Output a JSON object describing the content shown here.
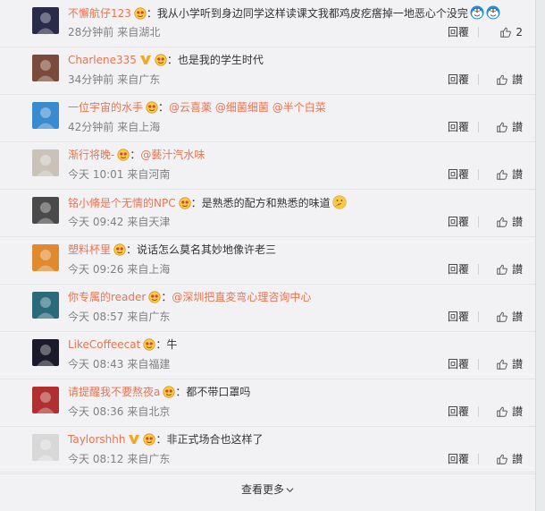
{
  "comments": [
    {
      "user": "不懈航仔123",
      "segments": [
        {
          "t": "：我从小学听到身边同学这样读课文我都鸡皮疙瘩掉一地恶心个没完",
          "m": false
        }
      ],
      "emojis": [
        "doraemon-emoji",
        "doraemon-emoji"
      ],
      "time": "28分钟前",
      "source": "来自湖北",
      "reply": "回覆",
      "likes": "2",
      "avatar_color": "#2a2a4a"
    },
    {
      "user": "Charlene335",
      "verified": true,
      "segments": [
        {
          "t": "：也是我的学生时代",
          "m": false
        }
      ],
      "time": "34分钟前",
      "source": "来自广东",
      "reply": "回覆",
      "likes": "讃",
      "avatar_color": "#7a4a3a"
    },
    {
      "user": "一位宇宙的水手",
      "segments": [
        {
          "t": "：",
          "m": false
        },
        {
          "t": "@云喜薬",
          "m": true
        },
        {
          "t": " ",
          "m": false
        },
        {
          "t": "@细菌细菌",
          "m": true
        },
        {
          "t": " ",
          "m": false
        },
        {
          "t": "@半个白菜",
          "m": true
        }
      ],
      "time": "42分钟前",
      "source": "来自上海",
      "reply": "回覆",
      "likes": "讃",
      "avatar_color": "#3a8ad0"
    },
    {
      "user": "渐行将晚-",
      "segments": [
        {
          "t": "：",
          "m": false
        },
        {
          "t": "@藝汁汽水味",
          "m": true
        }
      ],
      "time": "今天 10:01",
      "source": "来自河南",
      "reply": "回覆",
      "likes": "讃",
      "avatar_color": "#c8c2b8"
    },
    {
      "user": "铭小脩是个无情的NPC",
      "segments": [
        {
          "t": "：是熟悉的配方和熟悉的味道",
          "m": false
        }
      ],
      "emojis": [
        "thinking-emoji"
      ],
      "time": "今天 09:42",
      "source": "来自天津",
      "reply": "回覆",
      "likes": "讃",
      "avatar_color": "#4a4a4a"
    },
    {
      "user": "塑料杯里",
      "segments": [
        {
          "t": "：说话怎么莫名其妙地像许老三",
          "m": false
        }
      ],
      "time": "今天 09:26",
      "source": "来自上海",
      "reply": "回覆",
      "likes": "讃",
      "avatar_color": "#e08a30"
    },
    {
      "user": "你专属的reader",
      "segments": [
        {
          "t": "：",
          "m": false
        },
        {
          "t": "@深圳把直変弯心理咨询中心",
          "m": true
        }
      ],
      "time": "今天 08:57",
      "source": "来自广东",
      "reply": "回覆",
      "likes": "讃",
      "avatar_color": "#2a6a7a"
    },
    {
      "user": "LikeCoffeecat",
      "segments": [
        {
          "t": "：牛",
          "m": false
        }
      ],
      "time": "今天 08:43",
      "source": "来自福建",
      "reply": "回覆",
      "likes": "讃",
      "avatar_color": "#1a1a2a"
    },
    {
      "user": "请提醒我不要熬夜a",
      "segments": [
        {
          "t": "：都不带口罩吗",
          "m": false
        }
      ],
      "time": "今天 08:36",
      "source": "来自北京",
      "reply": "回覆",
      "likes": "讃",
      "avatar_color": "#b03030"
    },
    {
      "user": "Taylorshhh",
      "verified": true,
      "segments": [
        {
          "t": "：非正式场合也这样了",
          "m": false
        }
      ],
      "time": "今天 08:12",
      "source": "来自广东",
      "reply": "回覆",
      "likes": "讃",
      "avatar_color": "#d8d8d8"
    }
  ],
  "more_label": "查看更多"
}
